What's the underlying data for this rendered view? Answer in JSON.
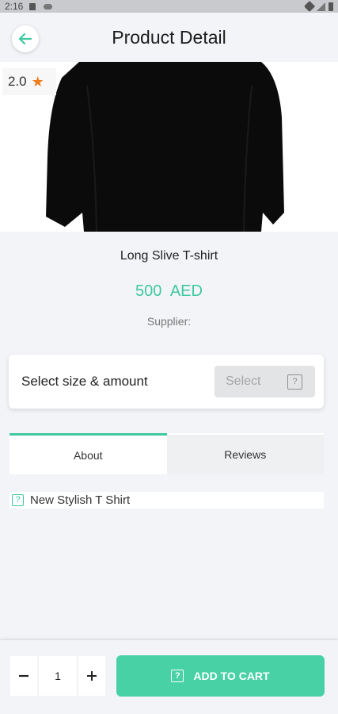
{
  "status_bar": {
    "time": "2:16"
  },
  "header": {
    "title": "Product Detail"
  },
  "product": {
    "rating": "2.0",
    "name": "Long Slive T-shirt",
    "price": "500 AED",
    "supplier_label": "Supplier:"
  },
  "selector": {
    "label": "Select size & amount",
    "button_label": "Select"
  },
  "tabs": [
    {
      "label": "About"
    },
    {
      "label": "Reviews"
    }
  ],
  "description": {
    "text": "New Stylish T Shirt"
  },
  "cart": {
    "quantity": "1",
    "add_label": "ADD TO CART"
  },
  "colors": {
    "accent": "#3ec9a0",
    "button": "#47d1a5",
    "star": "#f07d1c"
  },
  "icons": [
    "back-arrow-icon",
    "star-icon",
    "placeholder-icon",
    "minus-icon",
    "plus-icon"
  ]
}
